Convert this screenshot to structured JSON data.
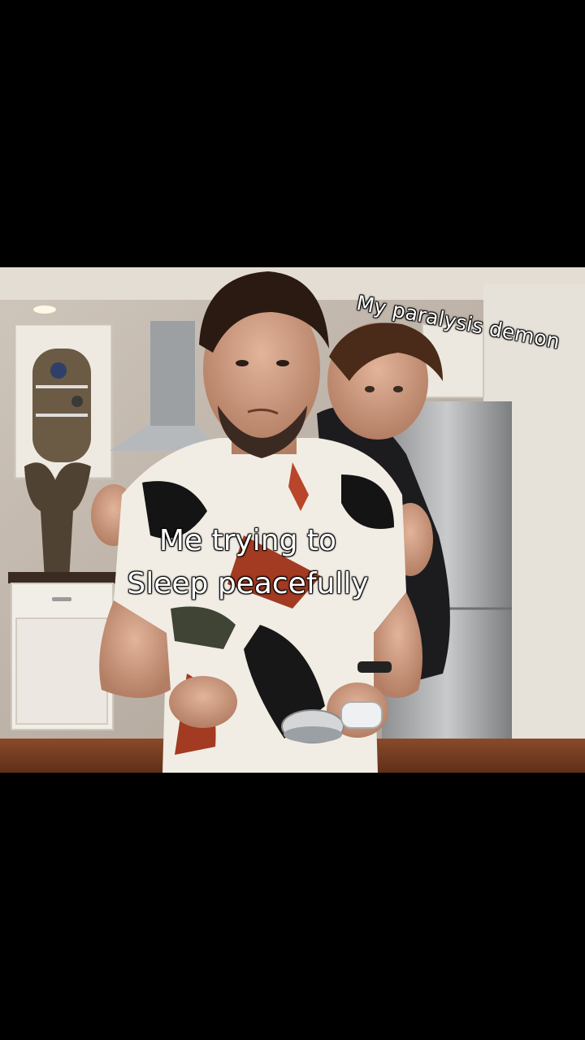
{
  "meme": {
    "top_caption": "My paralysis demon",
    "center_caption_line1": "Me trying to",
    "center_caption_line2": "Sleep peacefully"
  },
  "colors": {
    "letterbox": "#000000",
    "caption_text": "#ffffff",
    "caption_outline": "#000000"
  }
}
